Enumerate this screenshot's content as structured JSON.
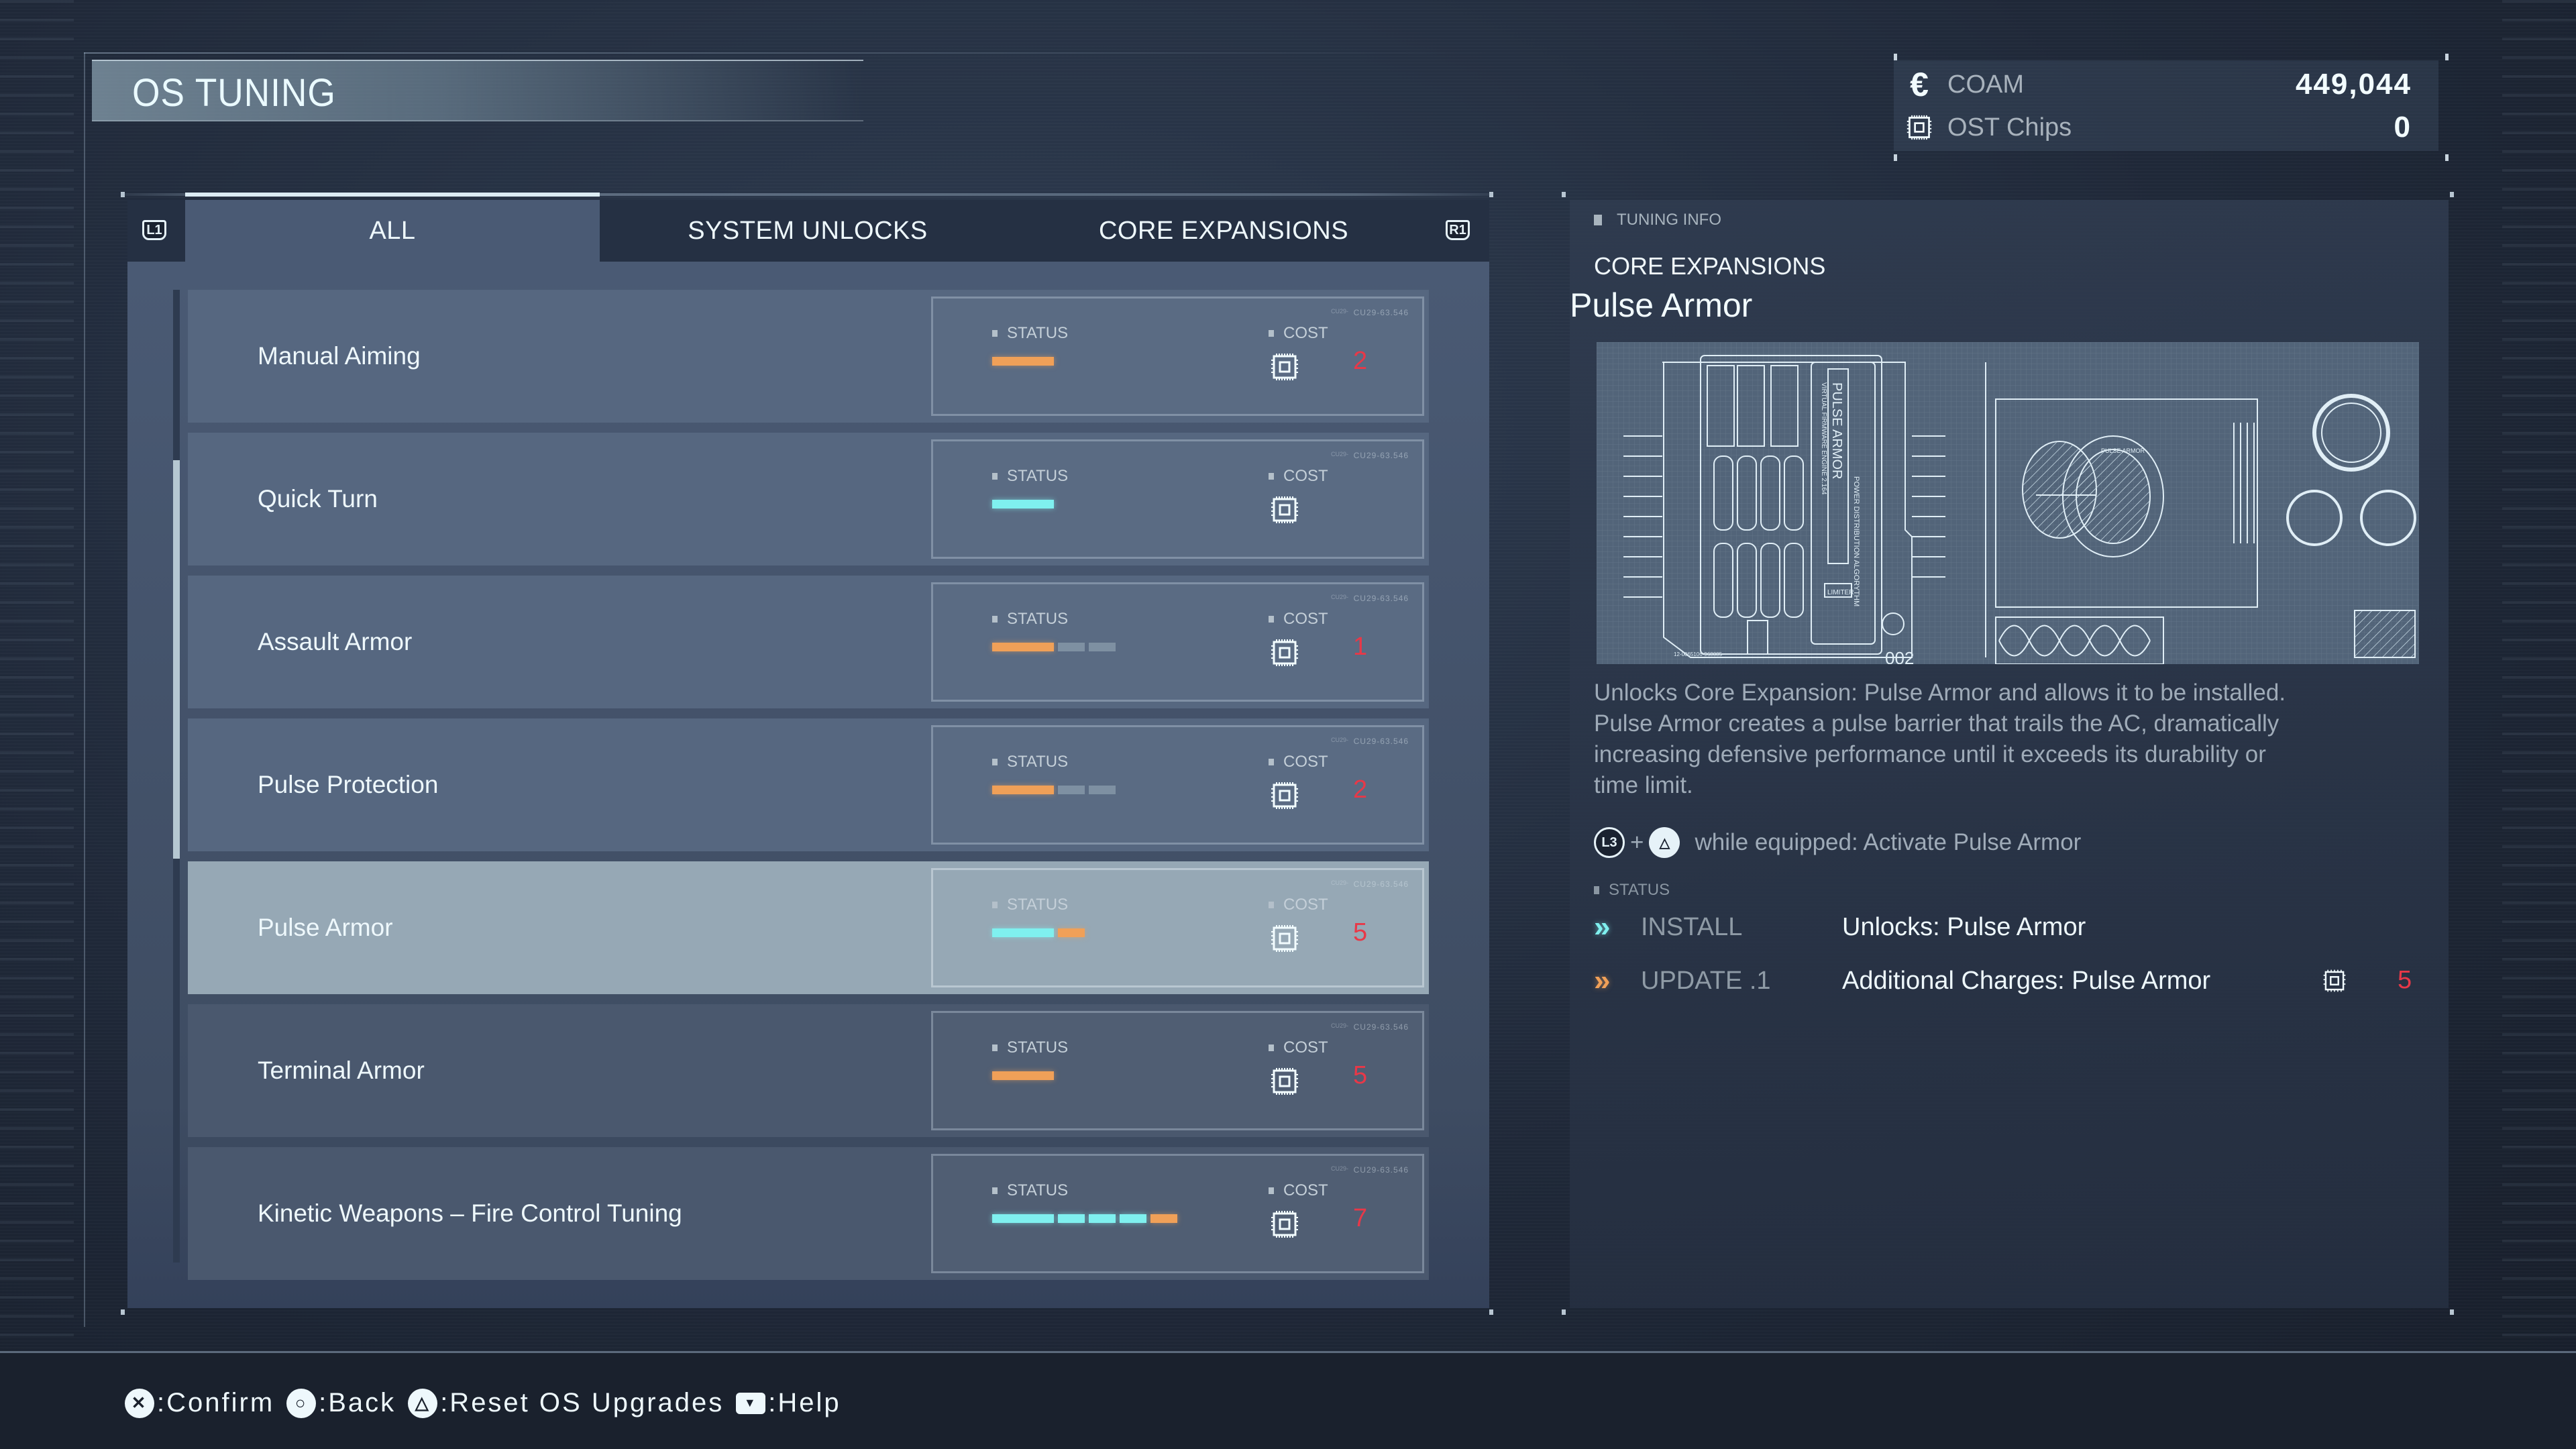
{
  "screen": {
    "title": "OS TUNING"
  },
  "currency": {
    "coam": {
      "icon": "coam-euro-icon",
      "glyph": "€",
      "label": "COAM",
      "value": "449,044"
    },
    "ost_chips": {
      "icon": "ost-chip-icon",
      "label": "OST Chips",
      "value": "0"
    }
  },
  "tabs": {
    "left_button": "L1",
    "right_button": "R1",
    "items": [
      {
        "label": "ALL",
        "active": true
      },
      {
        "label": "SYSTEM UNLOCKS",
        "active": false
      },
      {
        "label": "CORE EXPANSIONS",
        "active": false
      }
    ]
  },
  "list": {
    "status_label": "STATUS",
    "cost_label": "COST",
    "card_code": "CU29-63.546",
    "card_code_small": "CU29-",
    "scroll_position": {
      "thumb_start_fraction": 0.175,
      "thumb_size_fraction": 0.41
    },
    "colors": {
      "installed": "#7ff0ef",
      "available": "#f0a058",
      "locked": "#8597a8",
      "cost": "#e83848"
    },
    "items": [
      {
        "name": "Manual Aiming",
        "bars": [
          "orange"
        ],
        "cost": "2",
        "selected": false
      },
      {
        "name": "Quick Turn",
        "bars": [
          "cyan"
        ],
        "cost": "",
        "selected": false
      },
      {
        "name": "Assault Armor",
        "bars": [
          "orange",
          "empty",
          "empty"
        ],
        "cost": "1",
        "selected": false
      },
      {
        "name": "Pulse Protection",
        "bars": [
          "orange",
          "empty",
          "empty"
        ],
        "cost": "2",
        "selected": false
      },
      {
        "name": "Pulse Armor",
        "bars": [
          "cyan",
          "orange"
        ],
        "cost": "5",
        "selected": true
      },
      {
        "name": "Terminal Armor",
        "bars": [
          "orange"
        ],
        "cost": "5",
        "selected": false
      },
      {
        "name": "Kinetic Weapons – Fire Control Tuning",
        "bars": [
          "cyan",
          "cyan",
          "cyan",
          "cyan",
          "orange"
        ],
        "cost": "7",
        "selected": false
      }
    ]
  },
  "info": {
    "header": "TUNING INFO",
    "category": "CORE EXPANSIONS",
    "name": "Pulse Armor",
    "image": {
      "title": "PULSE ARMOR",
      "subtitle": "POWER DISTRIBUTION ALGORYTHM",
      "engine": "VIRTUAL FIRMWARE ENGINE 2.164",
      "number": "002",
      "serial": "12-0065106-968085",
      "diagram_label": "PULSE ARMOR",
      "limiter": "LIMITER"
    },
    "description": "Unlocks Core Expansion: Pulse Armor and allows it to be installed. Pulse Armor creates a pulse barrier that trails the AC, dramatically increasing defensive performance until it exceeds its durability or time limit.",
    "activation": {
      "button1": "L3",
      "plus": "+",
      "button2": "△",
      "text": "while equipped: Activate Pulse Armor"
    },
    "status_label": "STATUS",
    "upgrades": [
      {
        "state": "installed",
        "kind": "INSTALL",
        "description": "Unlocks: Pulse Armor",
        "cost": ""
      },
      {
        "state": "available",
        "kind": "UPDATE .1",
        "description": "Additional Charges: Pulse Armor",
        "cost": "5"
      }
    ]
  },
  "footer": {
    "hints": [
      {
        "button": "✕",
        "label": ":Confirm"
      },
      {
        "button": "○",
        "label": ":Back"
      },
      {
        "button": "△",
        "label": ":Reset OS Upgrades"
      },
      {
        "button": "▼",
        "label": ":Help"
      }
    ]
  }
}
